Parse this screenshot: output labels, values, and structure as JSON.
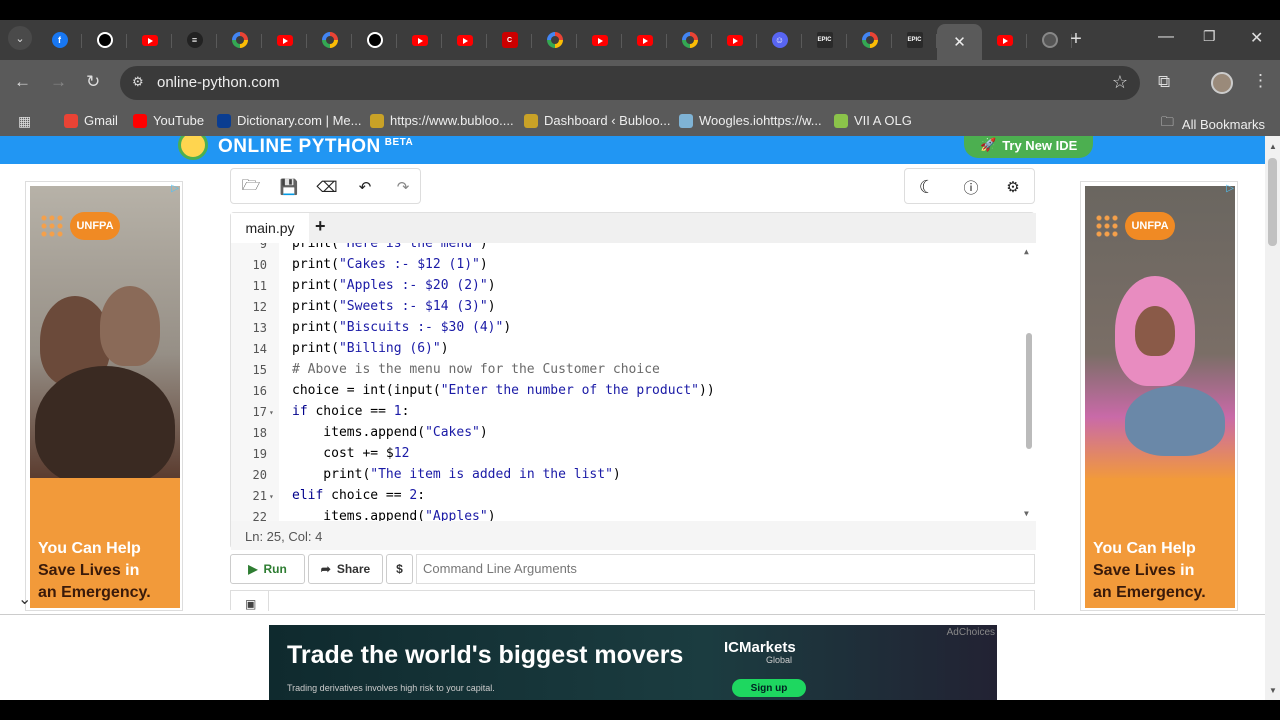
{
  "browser": {
    "tabs": [
      {
        "icon": "facebook-icon",
        "cls": "f-fb"
      },
      {
        "icon": "threads-icon",
        "cls": "f-th"
      },
      {
        "icon": "youtube-icon",
        "cls": "f-yt"
      },
      {
        "icon": "bubloo-icon",
        "cls": "f-bl"
      },
      {
        "icon": "google-icon",
        "cls": "f-g"
      },
      {
        "icon": "youtube-icon",
        "cls": "f-yt"
      },
      {
        "icon": "google-icon",
        "cls": "f-g"
      },
      {
        "icon": "threads-icon",
        "cls": "f-th"
      },
      {
        "icon": "youtube-icon",
        "cls": "f-yt"
      },
      {
        "icon": "youtube-icon",
        "cls": "f-yt"
      },
      {
        "icon": "icloud-icon",
        "cls": "f-ic"
      },
      {
        "icon": "google-icon",
        "cls": "f-g"
      },
      {
        "icon": "youtube-icon",
        "cls": "f-yt"
      },
      {
        "icon": "youtube-icon",
        "cls": "f-yt"
      },
      {
        "icon": "google-icon",
        "cls": "f-g"
      },
      {
        "icon": "youtube-icon",
        "cls": "f-yt"
      },
      {
        "icon": "discord-icon",
        "cls": "f-dc"
      },
      {
        "icon": "epic-games-icon",
        "cls": "f-ep"
      },
      {
        "icon": "google-icon",
        "cls": "f-g"
      },
      {
        "icon": "epic-games-icon",
        "cls": "f-ep"
      },
      {
        "icon": "close-icon",
        "cls": "active"
      },
      {
        "icon": "youtube-icon",
        "cls": "f-yt"
      },
      {
        "icon": "globe-icon",
        "cls": "f-tg"
      }
    ],
    "url": "online-python.com",
    "bookmarks": [
      {
        "label": "Gmail",
        "color": "#ea4335"
      },
      {
        "label": "YouTube",
        "color": "#ff0000"
      },
      {
        "label": "Dictionary.com | Me...",
        "color": "#0a3d91"
      },
      {
        "label": "https://www.bubloo....",
        "color": "#c9a227"
      },
      {
        "label": "Dashboard ‹ Bubloo...",
        "color": "#c9a227"
      },
      {
        "label": "Woogles.iohttps://w...",
        "color": "#7fb3d5"
      },
      {
        "label": "VII A OLG",
        "color": "#8bc34a"
      }
    ],
    "all_bookmarks": "All Bookmarks"
  },
  "site": {
    "brand": "ONLINE PYTHON",
    "beta": "BETA",
    "try_new_ide": "Try New IDE"
  },
  "editor": {
    "tab_label": "main.py",
    "add_tab": "+",
    "lines": [
      {
        "n": "9",
        "fold": "",
        "html": "print(\"Here is the menu\")"
      },
      {
        "n": "10",
        "fold": "",
        "html": "print(\"Cakes :- $12 (1)\")"
      },
      {
        "n": "11",
        "fold": "",
        "html": "print(\"Apples :- $20 (2)\")"
      },
      {
        "n": "12",
        "fold": "",
        "html": "print(\"Sweets :- $14 (3)\")"
      },
      {
        "n": "13",
        "fold": "",
        "html": "print(\"Biscuits :- $30 (4)\")"
      },
      {
        "n": "14",
        "fold": "",
        "html": "print(\"Billing (6)\")"
      },
      {
        "n": "15",
        "fold": "",
        "html": "# Above is the menu now for the Customer choice"
      },
      {
        "n": "16",
        "fold": "",
        "html": "choice = int(input(\"Enter the number of the product\"))"
      },
      {
        "n": "17",
        "fold": "▾",
        "html": "if choice == 1:"
      },
      {
        "n": "18",
        "fold": "",
        "html": "    items.append(\"Cakes\")"
      },
      {
        "n": "19",
        "fold": "",
        "html": "    cost += $12"
      },
      {
        "n": "20",
        "fold": "",
        "html": "    print(\"The item is added in the list\")"
      },
      {
        "n": "21",
        "fold": "▾",
        "html": "elif choice == 2:"
      },
      {
        "n": "22",
        "fold": "",
        "html": "    items.append(\"Apples\")"
      }
    ],
    "status": "Ln: 25,  Col: 4"
  },
  "actions": {
    "run": "Run",
    "share": "Share",
    "dollar": "$",
    "cmd_placeholder": "Command Line Arguments"
  },
  "ads": {
    "org": "UNFPA",
    "line1": "You Can Help",
    "line2a": "Save Lives",
    "line2b": " in",
    "line3": "an Emergency.",
    "bottom_headline": "Trade the world's biggest movers",
    "bottom_sub": "Trading derivatives involves high risk to your capital.",
    "brand": "ICMarkets",
    "brand_sub": "Global",
    "signup": "Sign up",
    "adchoices": "AdChoices"
  }
}
